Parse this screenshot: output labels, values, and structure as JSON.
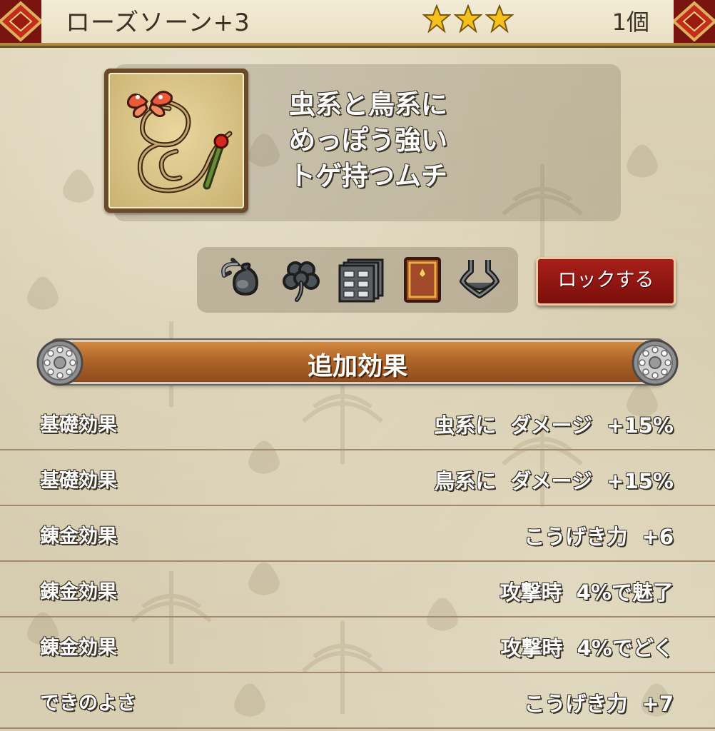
{
  "header": {
    "title": "ローズソーン+3",
    "stars": 3,
    "count": "1個"
  },
  "item": {
    "icon": "whip-with-butterfly-icon",
    "description": [
      "虫系と鳥系に",
      "めっぽう強い",
      "トゲ持つムチ"
    ]
  },
  "actions": {
    "icons": [
      "bag-refresh-icon",
      "clover-icon",
      "drawer-cabinet-icon",
      "book-icon",
      "body-armor-icon"
    ],
    "lock_label": "ロックする"
  },
  "section": {
    "title": "追加効果"
  },
  "effects": [
    {
      "label": "基礎効果",
      "value": "虫系に  ダメージ  +15%"
    },
    {
      "label": "基礎効果",
      "value": "鳥系に  ダメージ  +15%"
    },
    {
      "label": "錬金効果",
      "value": "こうげき力  +6"
    },
    {
      "label": "錬金効果",
      "value": "攻撃時  4%で魅了"
    },
    {
      "label": "錬金効果",
      "value": "攻撃時  4%でどく"
    },
    {
      "label": "できのよさ",
      "value": "こうげき力  +7"
    }
  ],
  "colors": {
    "accent_red": "#8c1410",
    "section_orange": "#b0652a",
    "star_gold": "#f5c01a"
  }
}
